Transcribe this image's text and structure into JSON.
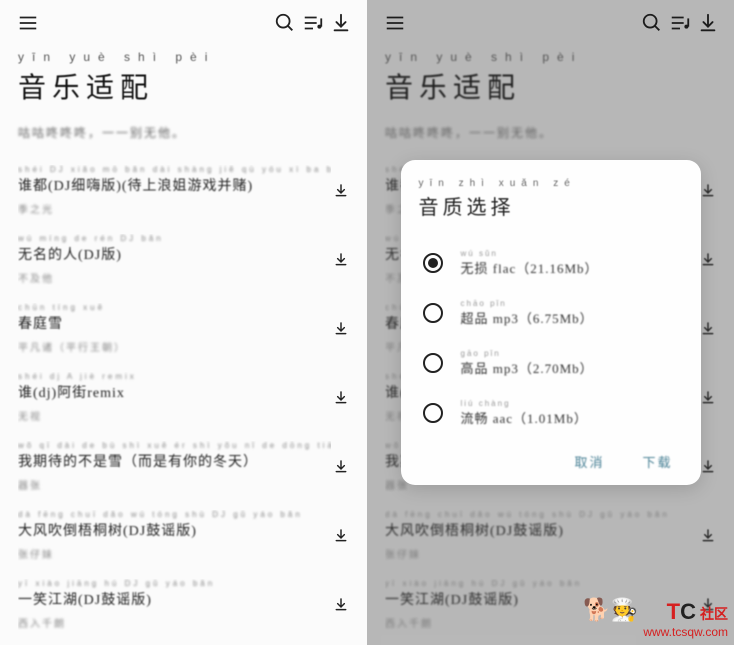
{
  "app": {
    "title_pinyin": "yīn yuè shì pèi",
    "title": "音乐适配",
    "subtitle": "咕咕咚咚咚，一一别无他。"
  },
  "songs": [
    {
      "pinyin": "shéi DJ xiǎo mō bǎn dài shàng jiě qù yóu xì ba ba",
      "title": "谁都(DJ细嗨版)(待上浪姐游戏并赌)",
      "artist": "季之光"
    },
    {
      "pinyin": "wú míng de rén DJ bǎn",
      "title": "无名的人(DJ版)",
      "artist": "不及他"
    },
    {
      "pinyin": "chūn tíng xuě",
      "title": "春庭雪",
      "artist": "平凡诸（平行王朝）"
    },
    {
      "pinyin": "shéi dj A jiè remix",
      "title": "谁(dj)阿街remix",
      "artist": "无视"
    },
    {
      "pinyin": "wǒ qī dài de bù shì xuě ér shì yǒu nǐ de dōng tiān",
      "title": "我期待的不是雪（而是有你的冬天）",
      "artist": "器张"
    },
    {
      "pinyin": "dà fēng chuī dǎo wú tóng shù DJ gǔ yáo bǎn",
      "title": "大风吹倒梧桐树(DJ鼓谣版)",
      "artist": "张仔妹"
    },
    {
      "pinyin": "yī xiào jiāng hú DJ gǔ yáo bǎn",
      "title": "一笑江湖(DJ鼓谣版)",
      "artist": "西入千朗"
    }
  ],
  "dialog": {
    "title_pinyin": "yīn zhì xuǎn zé",
    "title": "音质选择",
    "options": [
      {
        "pin": "wú sǔn",
        "label": "无损 flac（21.16Mb）",
        "selected": true
      },
      {
        "pin": "chāo pǐn",
        "label": "超品 mp3（6.75Mb）",
        "selected": false
      },
      {
        "pin": "gāo pǐn",
        "label": "高品 mp3（2.70Mb）",
        "selected": false
      },
      {
        "pin": "liú chàng",
        "label": "流畅 aac（1.01Mb）",
        "selected": false
      }
    ],
    "cancel": "取消",
    "confirm": "下载"
  },
  "watermark": {
    "t": "T",
    "c": "C",
    "tag": "社区",
    "url": "www.tcsqw.com"
  }
}
